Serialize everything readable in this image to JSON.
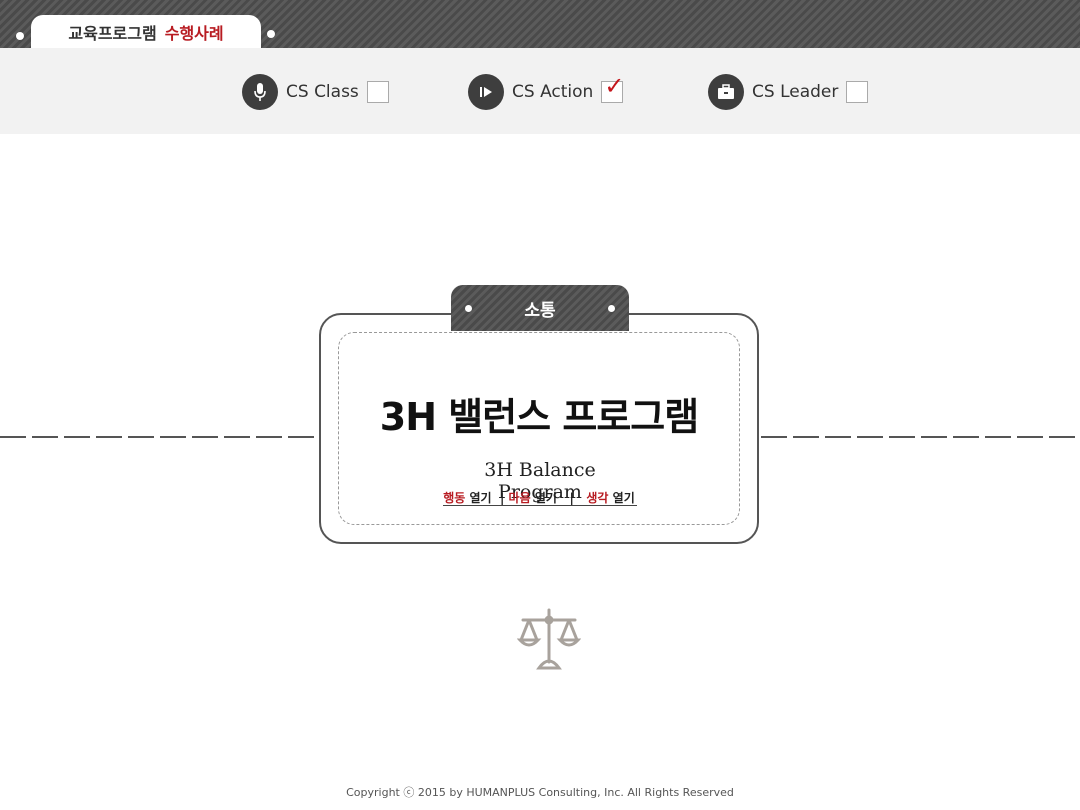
{
  "header": {
    "tab_part1": "교육프로그램",
    "tab_part2": "수행사례"
  },
  "categories": [
    {
      "label": "CS Class",
      "icon": "microphone-icon",
      "checked": false
    },
    {
      "label": "CS Action",
      "icon": "play-icon",
      "checked": true
    },
    {
      "label": "CS Leader",
      "icon": "briefcase-icon",
      "checked": false
    }
  ],
  "card": {
    "tag": "소통",
    "title_ko": "3H 밸런스 프로그램",
    "title_en": "3H Balance Program",
    "tagline": {
      "w1": "행동",
      "o1": "열기",
      "sep1": "|",
      "w2": "마음",
      "o2": "열기",
      "sep2": "|",
      "w3": "생각",
      "o3": "열기"
    }
  },
  "footer": {
    "copyright": "Copyright ⓒ 2015 by HUMANPLUS Consulting, Inc. All Rights Reserved"
  },
  "colors": {
    "accent": "#b81c22",
    "dark": "#3e3e3e",
    "bar": "#f2f2f2"
  }
}
